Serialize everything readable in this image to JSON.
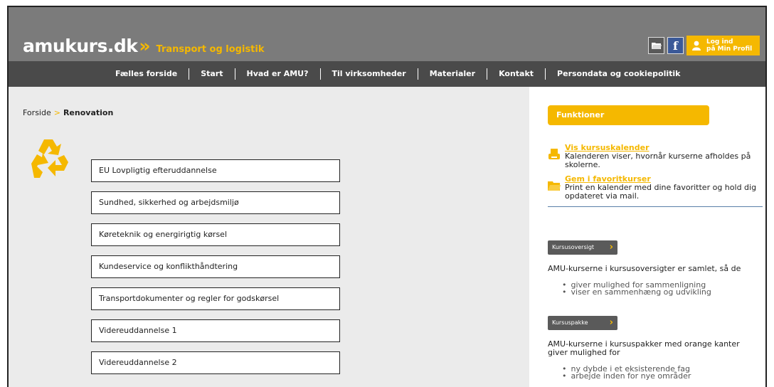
{
  "header": {
    "logo_text": "amukurs.dk",
    "logo_arrows": "»",
    "subtitle": "Transport og logistik",
    "login_line1": "Log ind",
    "login_line2": "på Min Profil",
    "icons": [
      "folder-icon",
      "facebook-icon",
      "user-icon"
    ]
  },
  "nav": {
    "items": [
      "Fælles forside",
      "Start",
      "Hvad er AMU?",
      "Til virksomheder",
      "Materialer",
      "Kontakt",
      "Persondata og cookiepolitik"
    ]
  },
  "breadcrumb": {
    "home": "Forside",
    "separator": ">",
    "current": "Renovation"
  },
  "courses": [
    "EU Lovpligtig efteruddannelse",
    "Sundhed, sikkerhed og arbejdsmiljø",
    "Køreteknik og energirigtig kørsel",
    "Kundeservice og konflikthåndtering",
    "Transportdokumenter og regler for godskørsel",
    "Videreuddannelse 1",
    "Videreuddannelse 2"
  ],
  "sidebar": {
    "functions_title": "Funktioner",
    "calendar_link": "Vis kursuskalender",
    "calendar_desc": "Kalenderen viser, hvornår kurserne afholdes på skolerne.",
    "favorites_link": "Gem i favoritkurser",
    "favorites_desc": "Print en kalender med dine favoritter og hold dig opdateret via mail.",
    "overview_tag": "Kursusoversigt",
    "overview_text": "AMU-kurserne i kursusoversigter er samlet, så de",
    "overview_bullets": [
      "giver mulighed for sammenligning",
      "viser en sammenhæng og udvikling"
    ],
    "package_tag": "Kursuspakke",
    "package_text": "AMU-kurserne i kursuspakker med orange kanter giver mulighed for",
    "package_bullets": [
      "ny dybde i et eksisterende fag",
      "arbejde inden for nye områder"
    ]
  },
  "colors": {
    "accent": "#f5b800",
    "header_bg": "#7b7b7b",
    "nav_bg": "#4a4a4a",
    "main_bg": "#ebebeb"
  }
}
